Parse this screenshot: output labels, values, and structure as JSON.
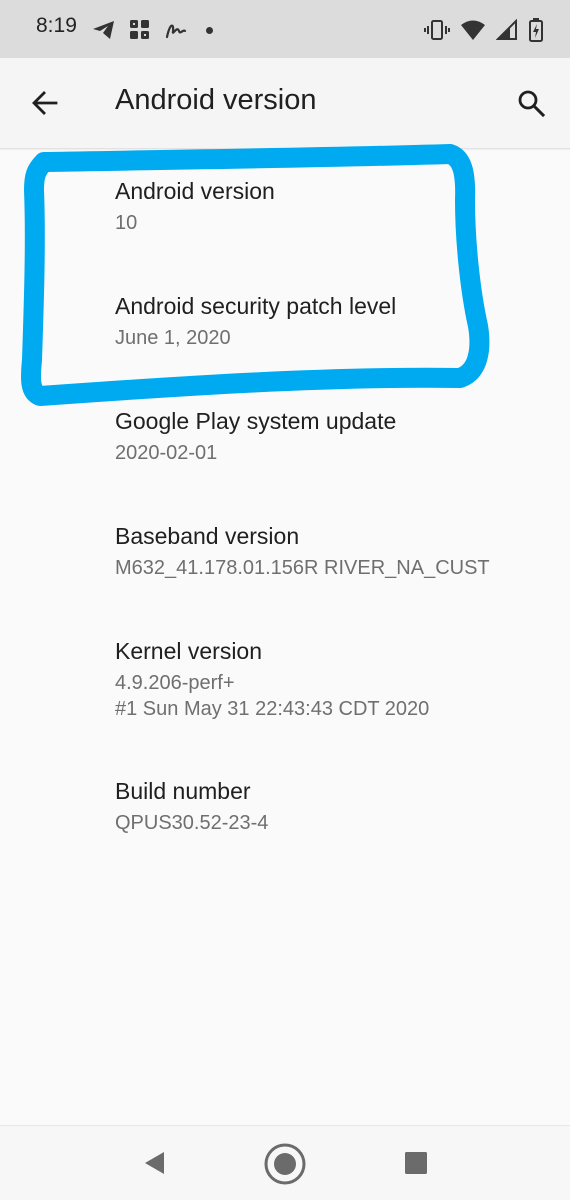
{
  "status_bar": {
    "time": "8:19",
    "left_icons": [
      "telegram-icon",
      "grid-app-icon",
      "signature-app-icon",
      "notification-dot-icon"
    ],
    "right_icons": [
      "vibrate-icon",
      "wifi-icon",
      "cell-signal-icon",
      "battery-charging-icon"
    ]
  },
  "app_bar": {
    "title": "Android version",
    "back_icon": "arrow-back-icon",
    "search_icon": "search-icon"
  },
  "items": [
    {
      "title": "Android version",
      "value": "10"
    },
    {
      "title": "Android security patch level",
      "value": "June 1, 2020"
    },
    {
      "title": "Google Play system update",
      "value": "2020-02-01"
    },
    {
      "title": "Baseband version",
      "value": "M632_41.178.01.156R RIVER_NA_CUST"
    },
    {
      "title": "Kernel version",
      "value_line1": "4.9.206-perf+",
      "value_line2": "#1 Sun May 31 22:43:43 CDT 2020"
    },
    {
      "title": "Build number",
      "value": "QPUS30.52-23-4"
    }
  ],
  "annotation": {
    "color": "#00aaf0",
    "target": "Android version and Android security patch level"
  },
  "nav_bar": {
    "back_icon": "nav-back-triangle-icon",
    "home_icon": "nav-home-circle-icon",
    "recents_icon": "nav-recents-square-icon"
  },
  "colors": {
    "status_bar_bg": "#dcdcdc",
    "app_bar_bg": "#f5f5f5",
    "page_bg": "#fafafa",
    "title_text": "#202020",
    "secondary_text": "#6f6f6f"
  }
}
